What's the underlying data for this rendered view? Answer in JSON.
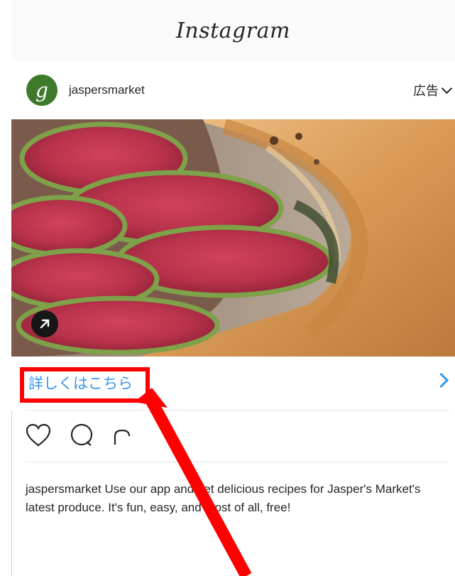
{
  "app": {
    "title": "Instagram"
  },
  "post": {
    "username": "jaspersmarket",
    "avatar_letter": "g",
    "sponsored_label": "広告",
    "cta_label": "詳しくはこちら",
    "caption_user": "jaspersmarket",
    "caption_text": " Use our app and get delicious recipes for Jasper's Market's latest produce. It's fun, easy, and most of all, free!"
  },
  "icons": {
    "dropdown": "chevron-down-icon",
    "external_link": "external-link-icon",
    "cta_arrow": "chevron-right-icon",
    "like": "heart-icon",
    "comment": "comment-icon",
    "share": "share-icon"
  },
  "colors": {
    "link_blue": "#3897f0",
    "annotation_red": "#ff0000"
  }
}
